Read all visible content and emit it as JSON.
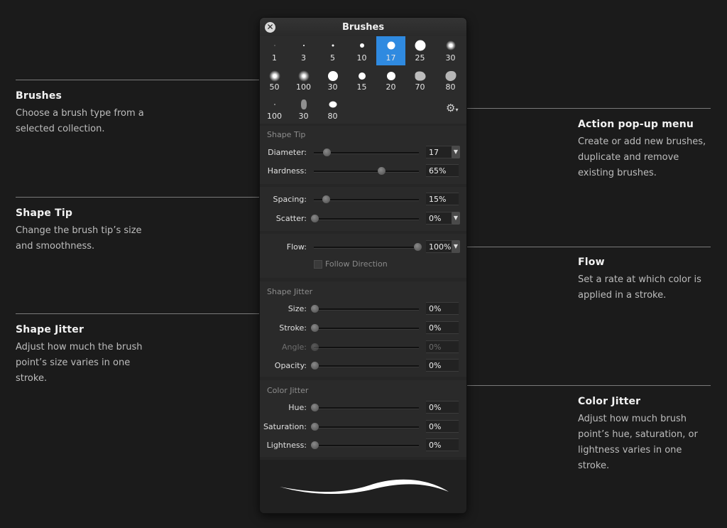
{
  "panel": {
    "title": "Brushes",
    "brush_sizes": [
      "1",
      "3",
      "5",
      "10",
      "17",
      "25",
      "30",
      "50",
      "100",
      "30",
      "15",
      "20",
      "70",
      "80",
      "100",
      "30",
      "80"
    ],
    "selected_index": 4,
    "shape_tip_title": "Shape Tip",
    "shape_jitter_title": "Shape Jitter",
    "color_jitter_title": "Color Jitter",
    "follow_direction_label": "Follow Direction",
    "diameter": {
      "label": "Diameter:",
      "value": "17"
    },
    "hardness": {
      "label": "Hardness:",
      "value": "65%"
    },
    "spacing": {
      "label": "Spacing:",
      "value": "15%"
    },
    "scatter": {
      "label": "Scatter:",
      "value": "0%"
    },
    "flow": {
      "label": "Flow:",
      "value": "100%"
    },
    "size": {
      "label": "Size:",
      "value": "0%"
    },
    "stroke": {
      "label": "Stroke:",
      "value": "0%"
    },
    "angle": {
      "label": "Angle:",
      "value": "0%"
    },
    "opacity": {
      "label": "Opacity:",
      "value": "0%"
    },
    "hue": {
      "label": "Hue:",
      "value": "0%"
    },
    "saturation": {
      "label": "Saturation:",
      "value": "0%"
    },
    "lightness": {
      "label": "Lightness:",
      "value": "0%"
    }
  },
  "annotations": {
    "brushes": {
      "title": "Brushes",
      "text": "Choose a brush type from a selected collection."
    },
    "shape_tip": {
      "title": "Shape Tip",
      "text": "Change the brush tip’s size and smoothness."
    },
    "shape_jitter": {
      "title": "Shape Jitter",
      "text": "Adjust how much the brush point’s size varies in one stroke."
    },
    "action_menu": {
      "title": "Action pop-up menu",
      "text": "Create or add new brushes, duplicate and remove existing brushes."
    },
    "flow": {
      "title": "Flow",
      "text": "Set a rate at which color is applied in a stroke."
    },
    "color_jitter": {
      "title": "Color Jitter",
      "text": "Adjust how much brush point’s hue, saturation, or lightness varies in one stroke."
    }
  },
  "colors": {
    "accent": "#2f8ae0",
    "background": "#1b1b1b",
    "panel": "#262626"
  }
}
